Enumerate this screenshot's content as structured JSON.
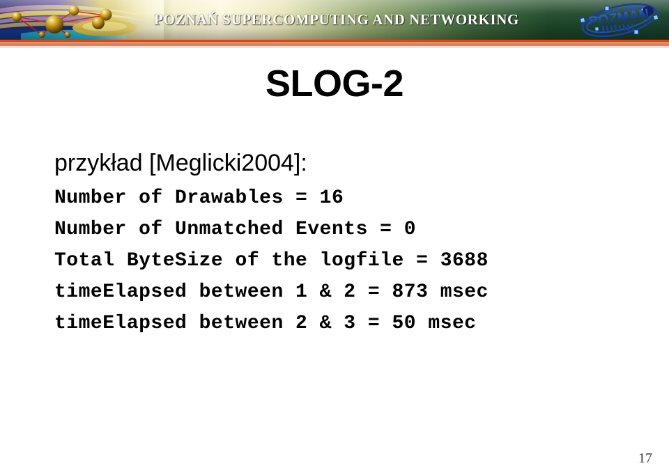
{
  "banner": {
    "organization": "POZNAŃ SUPERCOMPUTING AND NETWORKING",
    "logo_text": "POZMAN",
    "art_icon": "network-nodes-graphic",
    "logo_icon": "pozman-orbit-logo",
    "colors": {
      "banner_green": "#1d4a2a",
      "banner_cream": "#fdf8dc",
      "rule_orange": "#d84a12",
      "rule_salmon": "#d98360",
      "logo_blue": "#1b3fa0"
    }
  },
  "slide": {
    "title": "SLOG-2",
    "lead": "przykład [Meglicki2004]:",
    "code_lines": [
      "Number of Drawables = 16",
      "Number of Unmatched Events = 0",
      "Total ByteSize of the logfile = 3688",
      "timeElapsed between 1 & 2 = 873 msec",
      "timeElapsed between 2 & 3 = 50 msec"
    ],
    "page_number": "17"
  }
}
